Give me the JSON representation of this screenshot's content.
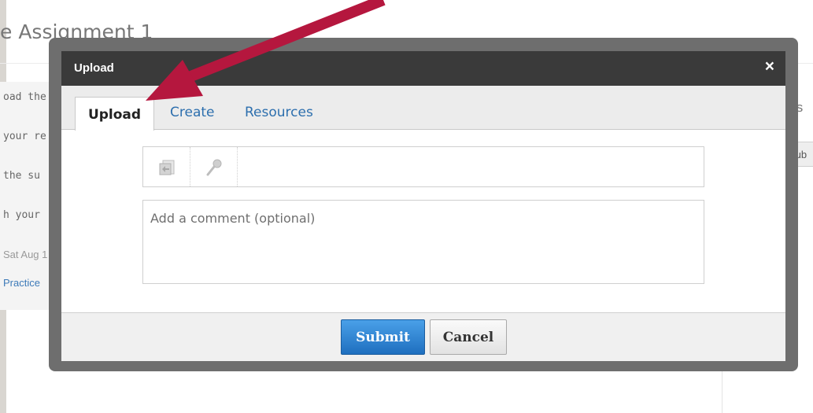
{
  "page": {
    "title": "e Assignment 1",
    "content_lines": [
      "oad the",
      "your re",
      " the su",
      "h your"
    ],
    "meta_date": "Sat Aug 1",
    "link_text": "Practice",
    "sidebar_heading": "niss",
    "sidebar_button": "Sub"
  },
  "dialog": {
    "title": "Upload",
    "close_glyph": "×",
    "tabs": {
      "upload": "Upload",
      "create": "Create",
      "resources": "Resources"
    },
    "toolbar": {
      "icons": [
        "file-upload-icon",
        "microphone-icon"
      ]
    },
    "comment": {
      "value": "",
      "placeholder": "Add a comment (optional)"
    },
    "footer": {
      "submit_label": "Submit",
      "cancel_label": "Cancel"
    }
  },
  "annotation": {
    "arrow_color": "#b5173e",
    "points_to": "tab-upload"
  },
  "colors": {
    "header_bg": "#3a3a3a",
    "tab_link": "#2d6fae",
    "submit_bg": "#2a7fd0",
    "frame": "#6e6e6e"
  }
}
